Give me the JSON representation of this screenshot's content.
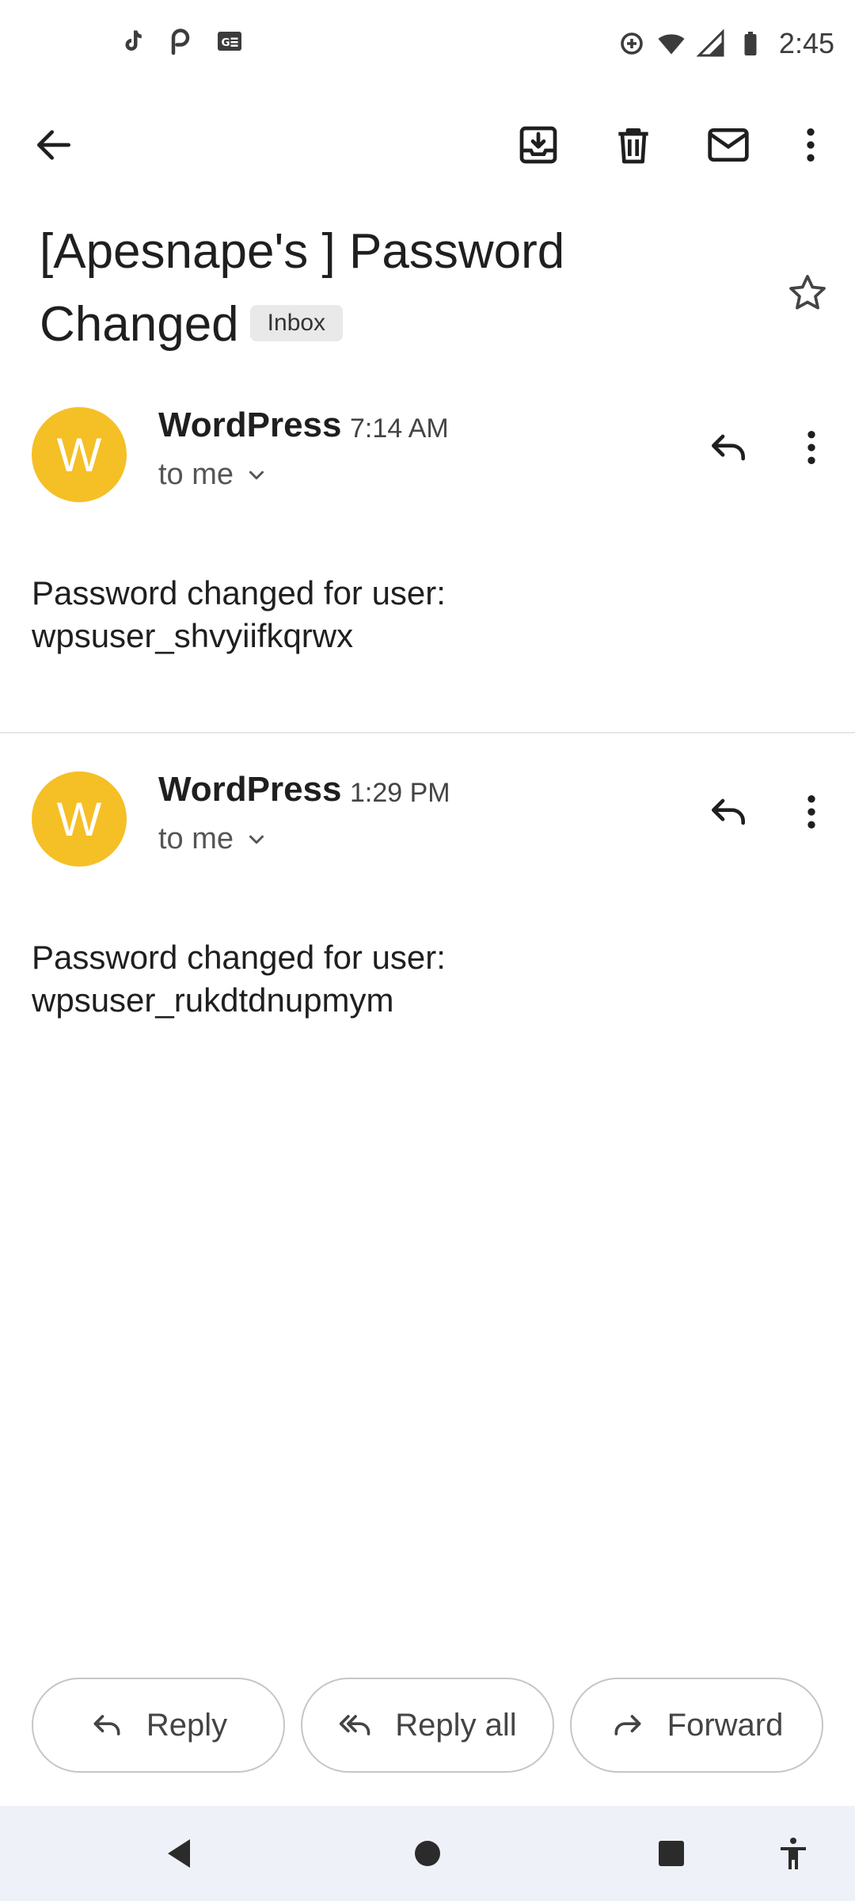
{
  "status_bar": {
    "time": "2:45",
    "left_icons": [
      "tiktok-icon",
      "pinterest-icon",
      "news-icon"
    ],
    "right_icons": [
      "data-saver-icon",
      "wifi-icon",
      "signal-icon",
      "battery-icon"
    ]
  },
  "toolbar": {
    "back": "arrow-left-icon",
    "actions": [
      "archive-icon",
      "delete-icon",
      "mark-unread-icon",
      "more-vert-icon"
    ]
  },
  "subject": {
    "text": "[Apesnape's ] Password Changed",
    "label": "Inbox"
  },
  "messages": [
    {
      "avatar_letter": "W",
      "sender": "WordPress",
      "time": "7:14 AM",
      "recipient": "to me",
      "body_line1": "Password changed for user:",
      "body_line2": "wpsuser_shvyiifkqrwx"
    },
    {
      "avatar_letter": "W",
      "sender": "WordPress",
      "time": "1:29 PM",
      "recipient": "to me",
      "body_line1": "Password changed for user:",
      "body_line2": "wpsuser_rukdtdnupmym"
    }
  ],
  "actions": {
    "reply": "Reply",
    "reply_all": "Reply all",
    "forward": "Forward"
  },
  "colors": {
    "avatar": "#f5bf26",
    "nav_bar": "#eef1f8"
  }
}
